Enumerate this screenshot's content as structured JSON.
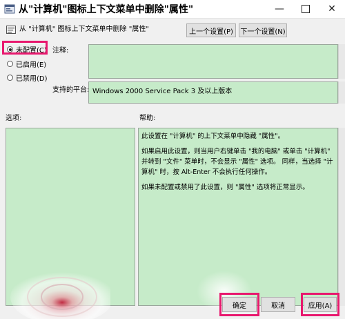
{
  "window": {
    "title": "从\"计算机\"图标上下文菜单中删除\"属性\"",
    "controls": {
      "minimize": "—",
      "close": "✕"
    }
  },
  "header": {
    "policy_name": "从 \"计算机\" 图标上下文菜单中删除 \"属性\"",
    "prev_label": "上一个设置(P)",
    "next_label": "下一个设置(N)"
  },
  "state": {
    "options": [
      {
        "label": "未配置(C)",
        "selected": true
      },
      {
        "label": "已启用(E)",
        "selected": false
      },
      {
        "label": "已禁用(D)",
        "selected": false
      }
    ]
  },
  "comment": {
    "label": "注释:"
  },
  "platform": {
    "label": "支持的平台:",
    "value": "Windows 2000 Service Pack 3 及以上版本"
  },
  "options_panel": {
    "label": "选项:"
  },
  "help_panel": {
    "label": "帮助:",
    "paragraphs": [
      "此设置在 \"计算机\" 的上下文菜单中隐藏 \"属性\"。",
      "如果启用此设置，则当用户右键单击 \"我的电脑\" 或单击 \"计算机\" 并转到 \"文件\" 菜单时，不会显示 \"属性\" 选项。 同样，当选择 \"计算机\" 时，按 Alt-Enter 不会执行任何操作。",
      "如果未配置或禁用了此设置，则 \"属性\" 选项将正常显示。"
    ]
  },
  "footer": {
    "ok_label": "确定",
    "cancel_label": "取消",
    "apply_label": "应用(A)"
  },
  "colors": {
    "highlight": "#e8186e",
    "panel_green": "#c6ebc9",
    "window_bg": "#f0f0f0"
  }
}
